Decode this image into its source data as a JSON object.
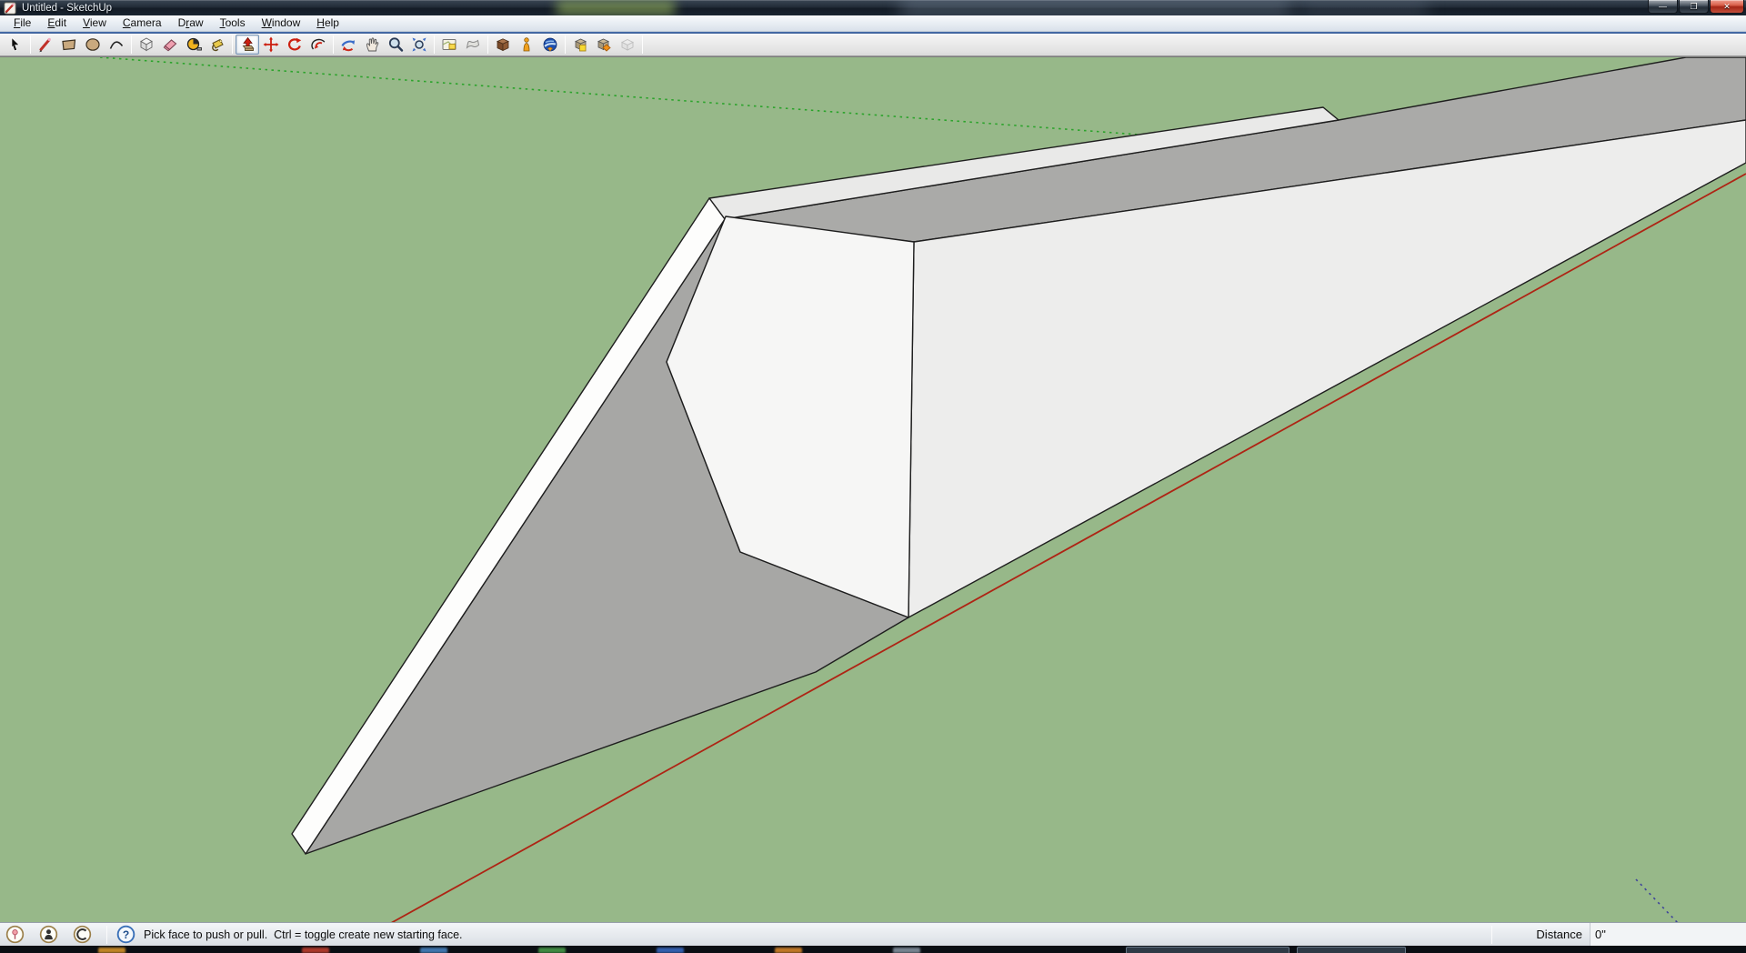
{
  "window": {
    "title": "Untitled - SketchUp",
    "minimize_glyph": "—",
    "restore_glyph": "❐",
    "close_glyph": "✕"
  },
  "menu": {
    "items": [
      {
        "label": "File"
      },
      {
        "label": "Edit"
      },
      {
        "label": "View"
      },
      {
        "label": "Camera"
      },
      {
        "label": "Draw"
      },
      {
        "label": "Tools"
      },
      {
        "label": "Window"
      },
      {
        "label": "Help"
      }
    ]
  },
  "toolbar": {
    "tools": [
      "select",
      "line",
      "rectangle",
      "circle",
      "arc",
      "make-component",
      "eraser",
      "tape-measure",
      "paint-bucket",
      "push-pull",
      "move",
      "rotate",
      "offset",
      "orbit",
      "pan",
      "zoom",
      "zoom-extents",
      "add-location",
      "toggle-terrain",
      "photo-textures-building",
      "person",
      "preview-in-google-earth",
      "get-models",
      "share-model",
      "share-component"
    ],
    "active_tool": "push-pull"
  },
  "statusbar": {
    "message": "Pick face to push or pull.  Ctrl = toggle create new starting face.",
    "help_glyph": "?",
    "distance_label": "Distance",
    "distance_value": "0\""
  },
  "viewport": {
    "axes": {
      "red": "#AE2414",
      "green": "#2BA32B",
      "blue": "#30309E"
    }
  },
  "colors": {
    "ground": "#97B889",
    "face_front": "#F6F6F5",
    "face_band": "#FDFDFC",
    "face_top": "#E9E9E8",
    "face_right": "#EDEDEC",
    "face_shadow": "#A7A7A5",
    "face_back": "#AAAAA8",
    "edge": "#1E1E1E"
  }
}
